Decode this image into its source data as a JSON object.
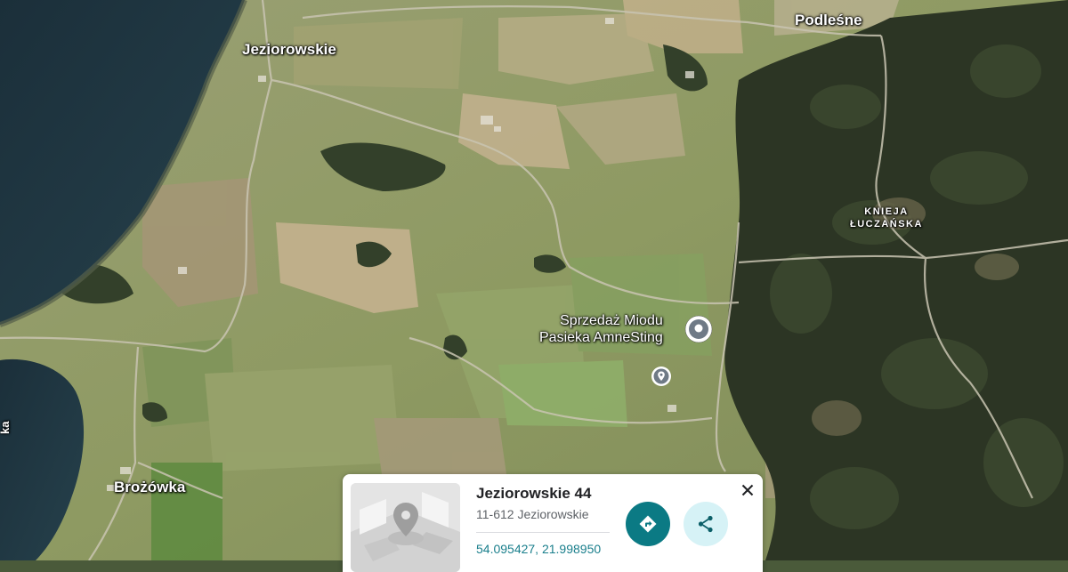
{
  "map": {
    "type": "satellite",
    "place_labels": {
      "jeziorowskie": "Jeziorowskie",
      "podlesne": "Podleśne",
      "brozowka": "Brożówka",
      "knieja_line1": "KNIEJA",
      "knieja_line2": "ŁUCZAŃSKA",
      "lake_fragment": "ka"
    },
    "poi": {
      "name_line1": "Sprzedaż Miodu",
      "name_line2": "Pasieka AmneSting",
      "icon": "location-pin-icon"
    },
    "secondary_pin_icon": "location-pin-icon",
    "colors": {
      "water": "#1e3642",
      "field": "#8f9a68",
      "forest": "#2b3522",
      "accent": "#0b7a84"
    }
  },
  "place_card": {
    "title": "Jeziorowskie 44",
    "address": "11-612 Jeziorowskie",
    "coordinates": "54.095427, 21.998950",
    "icons": {
      "directions": "directions-icon",
      "share": "share-icon",
      "close": "close-icon",
      "thumbnail": "map-placeholder-icon"
    }
  }
}
